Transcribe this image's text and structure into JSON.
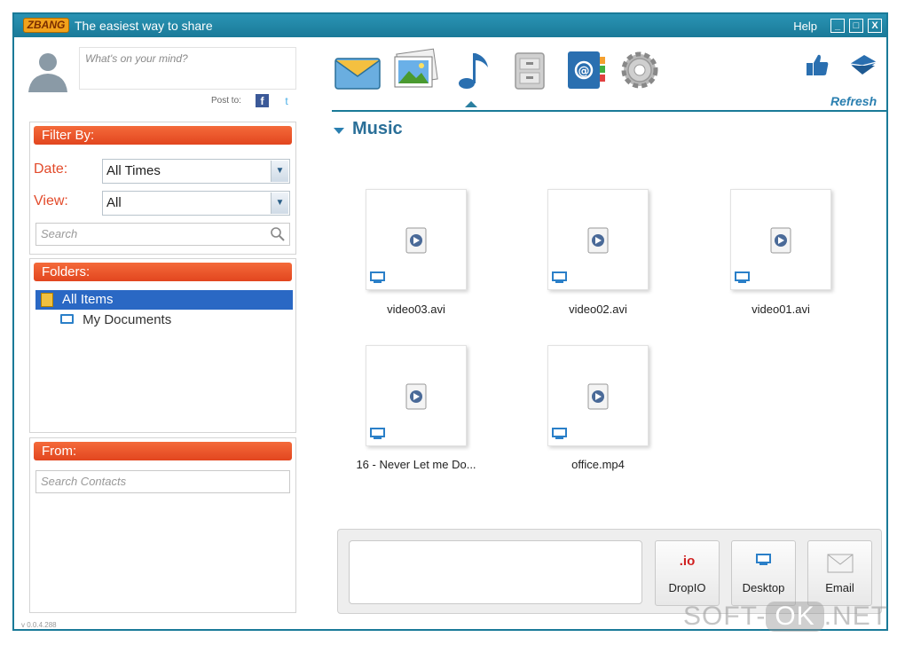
{
  "titlebar": {
    "logo": "ZBANG",
    "tagline": "The easiest way to share",
    "help": "Help",
    "minimize": "_",
    "maximize": "□",
    "close": "X"
  },
  "status": {
    "placeholder": "What's on your mind?",
    "post_to": "Post to:",
    "facebook_glyph": "f",
    "twitter_glyph": "t"
  },
  "filter": {
    "title": "Filter By:",
    "date_label": "Date:",
    "date_value": "All Times",
    "view_label": "View:",
    "view_value": "All",
    "search_placeholder": "Search"
  },
  "folders": {
    "title": "Folders:",
    "items": [
      {
        "label": "All Items",
        "selected": true,
        "icon": "folder-icon"
      },
      {
        "label": "My Documents",
        "selected": false,
        "icon": "computer-icon"
      }
    ]
  },
  "from": {
    "title": "From:",
    "search_placeholder": "Search Contacts"
  },
  "version": "v 0.0.4.288",
  "toolbar": {
    "icons": [
      "mail-icon",
      "photos-icon",
      "music-icon",
      "documents-icon",
      "contacts-icon",
      "settings-icon"
    ],
    "active": "music-icon",
    "refresh": "Refresh",
    "like_icon": "thumbs-up-icon",
    "send_icon": "envelope-icon"
  },
  "section": {
    "title": "Music"
  },
  "files": [
    {
      "name": "video03.avi"
    },
    {
      "name": "video02.avi"
    },
    {
      "name": "video01.avi"
    },
    {
      "name": "16 - Never Let me Do..."
    },
    {
      "name": "office.mp4"
    }
  ],
  "share": {
    "dropio_icon": ".io",
    "dropio_label": "DropIO",
    "desktop_label": "Desktop",
    "email_label": "Email"
  },
  "watermark": {
    "left": "SOFT-",
    "ok": "OK",
    "right": ".NET"
  },
  "colors": {
    "titlebar": "#1a7a98",
    "panel_header": "#e2461f",
    "selection": "#2a68c4",
    "accent_text": "#2a6f98"
  }
}
